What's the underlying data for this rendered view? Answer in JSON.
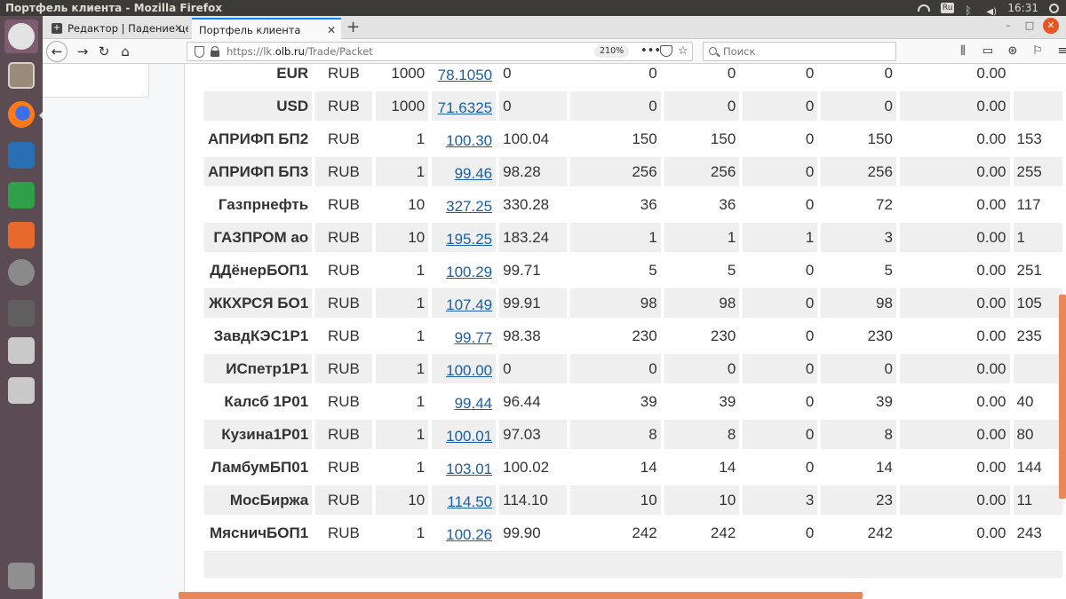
{
  "os": {
    "window_title": "Портфель клиента - Mozilla Firefox",
    "keyboard_layout": "Ru",
    "clock": "16:31"
  },
  "browser": {
    "tabs": [
      {
        "label": "Редактор | Падение це",
        "active": false
      },
      {
        "label": "Портфель клиента",
        "active": true
      }
    ],
    "new_tab": "+",
    "url_prefix": "https://lk.",
    "url_domain": "olb.ru",
    "url_path": "/Trade/Packet",
    "zoom": "210%",
    "search_placeholder": "Поиск"
  },
  "table": {
    "rows": [
      {
        "name": "EUR",
        "currency": "RUB",
        "lot": "1000",
        "price": "78.1050",
        "market": "0",
        "c1": "0",
        "c2": "0",
        "c3": "0",
        "c4": "0",
        "c5": "0.00",
        "c6": ""
      },
      {
        "name": "USD",
        "currency": "RUB",
        "lot": "1000",
        "price": "71.6325",
        "market": "0",
        "c1": "0",
        "c2": "0",
        "c3": "0",
        "c4": "0",
        "c5": "0.00",
        "c6": ""
      },
      {
        "name": "АПРИФП БП2",
        "currency": "RUB",
        "lot": "1",
        "price": "100.30",
        "market": "100.04",
        "c1": "150",
        "c2": "150",
        "c3": "0",
        "c4": "150",
        "c5": "0.00",
        "c6": "153"
      },
      {
        "name": "АПРИФП БП3",
        "currency": "RUB",
        "lot": "1",
        "price": "99.46",
        "market": "98.28",
        "c1": "256",
        "c2": "256",
        "c3": "0",
        "c4": "256",
        "c5": "0.00",
        "c6": "255"
      },
      {
        "name": "Газпрнефть",
        "currency": "RUB",
        "lot": "10",
        "price": "327.25",
        "market": "330.28",
        "c1": "36",
        "c2": "36",
        "c3": "0",
        "c4": "72",
        "c5": "0.00",
        "c6": "117"
      },
      {
        "name": "ГАЗПРОМ ао",
        "currency": "RUB",
        "lot": "10",
        "price": "195.25",
        "market": "183.24",
        "c1": "1",
        "c2": "1",
        "c3": "1",
        "c4": "3",
        "c5": "0.00",
        "c6": "1"
      },
      {
        "name": "ДДёнерБОП1",
        "currency": "RUB",
        "lot": "1",
        "price": "100.29",
        "market": "99.71",
        "c1": "5",
        "c2": "5",
        "c3": "0",
        "c4": "5",
        "c5": "0.00",
        "c6": "251"
      },
      {
        "name": "ЖКХРСЯ БО1",
        "currency": "RUB",
        "lot": "1",
        "price": "107.49",
        "market": "99.91",
        "c1": "98",
        "c2": "98",
        "c3": "0",
        "c4": "98",
        "c5": "0.00",
        "c6": "105"
      },
      {
        "name": "ЗавдКЭС1Р1",
        "currency": "RUB",
        "lot": "1",
        "price": "99.77",
        "market": "98.38",
        "c1": "230",
        "c2": "230",
        "c3": "0",
        "c4": "230",
        "c5": "0.00",
        "c6": "235"
      },
      {
        "name": "ИСпетр1Р1",
        "currency": "RUB",
        "lot": "1",
        "price": "100.00",
        "market": "0",
        "c1": "0",
        "c2": "0",
        "c3": "0",
        "c4": "0",
        "c5": "0.00",
        "c6": ""
      },
      {
        "name": "Калсб 1Р01",
        "currency": "RUB",
        "lot": "1",
        "price": "99.44",
        "market": "96.44",
        "c1": "39",
        "c2": "39",
        "c3": "0",
        "c4": "39",
        "c5": "0.00",
        "c6": "40"
      },
      {
        "name": "Кузина1Р01",
        "currency": "RUB",
        "lot": "1",
        "price": "100.01",
        "market": "97.03",
        "c1": "8",
        "c2": "8",
        "c3": "0",
        "c4": "8",
        "c5": "0.00",
        "c6": "80"
      },
      {
        "name": "ЛамбумБП01",
        "currency": "RUB",
        "lot": "1",
        "price": "103.01",
        "market": "100.02",
        "c1": "14",
        "c2": "14",
        "c3": "0",
        "c4": "14",
        "c5": "0.00",
        "c6": "144"
      },
      {
        "name": "МосБиржа",
        "currency": "RUB",
        "lot": "10",
        "price": "114.50",
        "market": "114.10",
        "c1": "10",
        "c2": "10",
        "c3": "3",
        "c4": "23",
        "c5": "0.00",
        "c6": "11"
      },
      {
        "name": "МясничБОП1",
        "currency": "RUB",
        "lot": "1",
        "price": "100.26",
        "market": "99.90",
        "c1": "242",
        "c2": "242",
        "c3": "0",
        "c4": "242",
        "c5": "0.00",
        "c6": "243"
      }
    ]
  }
}
